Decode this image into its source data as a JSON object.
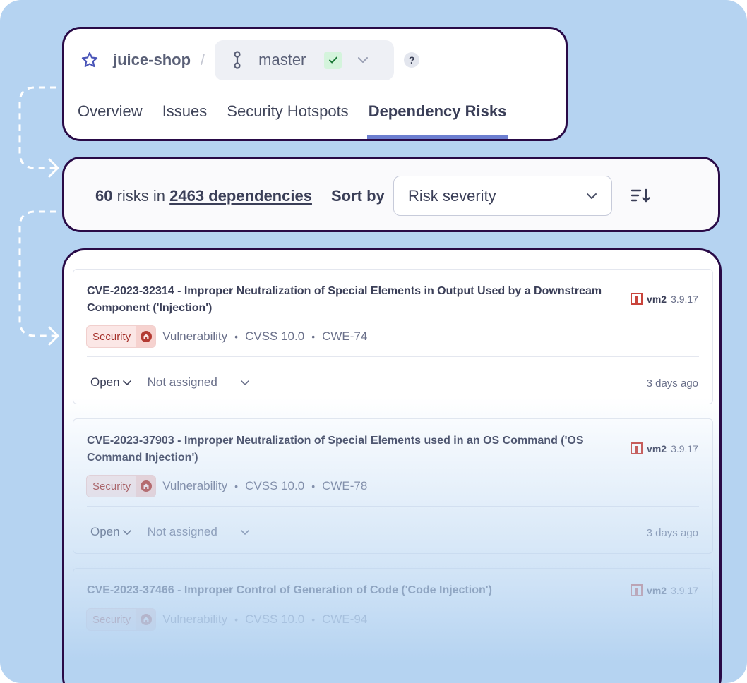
{
  "header": {
    "project": "juice-shop",
    "separator": "/",
    "branch": "master",
    "help": "?",
    "tabs": [
      {
        "label": "Overview"
      },
      {
        "label": "Issues"
      },
      {
        "label": "Security Hotspots"
      },
      {
        "label": "Dependency Risks",
        "active": true
      }
    ]
  },
  "filter": {
    "risk_count": "60",
    "risks_in": " risks in ",
    "dependencies": "2463 dependencies",
    "sort_label": "Sort by",
    "sort_value": "Risk severity"
  },
  "risks": [
    {
      "title": "CVE-2023-32314 - Improper Neutralization of Special Elements in Output Used by a Downstream Component ('Injection')",
      "package": "vm2",
      "version": "3.9.17",
      "badge": "Security",
      "type": "Vulnerability",
      "cvss": "CVSS 10.0",
      "cwe": "CWE-74",
      "status": "Open",
      "assignee": "Not assigned",
      "age": "3 days ago"
    },
    {
      "title": "CVE-2023-37903 - Improper Neutralization of Special Elements used in an OS Command ('OS Command Injection')",
      "package": "vm2",
      "version": "3.9.17",
      "badge": "Security",
      "type": "Vulnerability",
      "cvss": "CVSS 10.0",
      "cwe": "CWE-78",
      "status": "Open",
      "assignee": "Not assigned",
      "age": "3 days ago"
    },
    {
      "title": "CVE-2023-37466 - Improper Control of Generation of Code ('Code Injection')",
      "package": "vm2",
      "version": "3.9.17",
      "badge": "Security",
      "type": "Vulnerability",
      "cvss": "CVSS 10.0",
      "cwe": "CWE-94"
    }
  ],
  "icons": {
    "star": "star-icon",
    "branch": "branch-icon",
    "check": "check-icon",
    "chevron": "chevron-down-icon",
    "sort": "sort-order-icon",
    "npm": "npm-icon",
    "security": "shield-icon"
  },
  "colors": {
    "background": "#b5d3f1",
    "frame": "#290a47",
    "accent": "#6c7ed0",
    "security_text": "#a5302a",
    "security_bg": "#fbe7e6",
    "success_bg": "#d4f4dc"
  }
}
